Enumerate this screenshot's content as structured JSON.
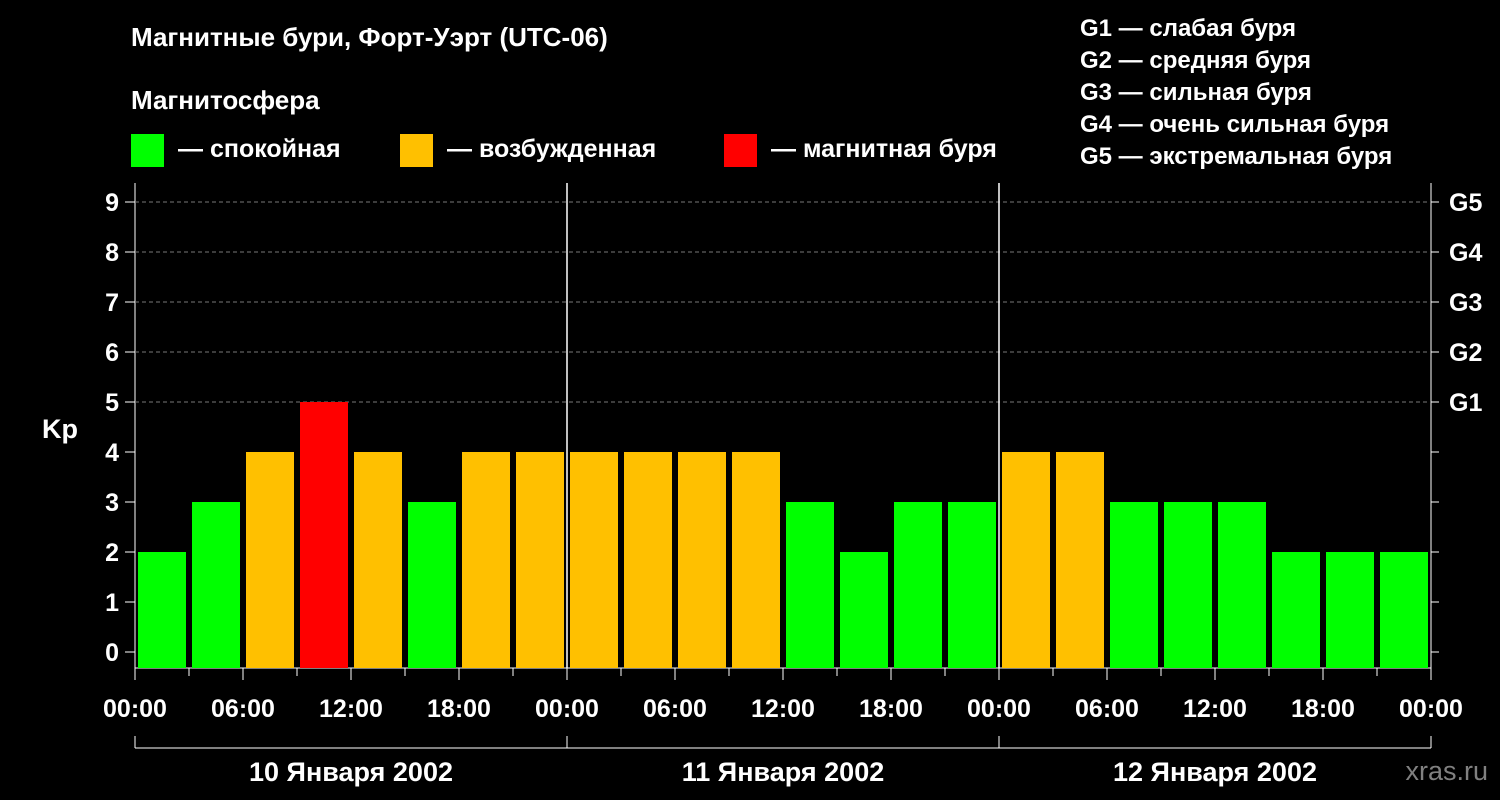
{
  "header": {
    "title": "Магнитные бури, Форт-Уэрт (UTC-06)",
    "subtitle": "Магнитосфера"
  },
  "legend": [
    {
      "label": "— спокойная",
      "color": "#00ff00"
    },
    {
      "label": "— возбужденная",
      "color": "#ffc000"
    },
    {
      "label": "— магнитная буря",
      "color": "#ff0000"
    }
  ],
  "g_scale": [
    "G1 — слабая буря",
    "G2 — средняя буря",
    "G3 — сильная буря",
    "G4 — очень сильная буря",
    "G5 — экстремальная буря"
  ],
  "watermark": "xras.ru",
  "chart_data": {
    "type": "bar",
    "ylabel": "Kp",
    "ylim": [
      0,
      9
    ],
    "y_ticks": [
      0,
      1,
      2,
      3,
      4,
      5,
      6,
      7,
      8,
      9
    ],
    "right_axis_labels": [
      {
        "y": 5,
        "label": "G1"
      },
      {
        "y": 6,
        "label": "G2"
      },
      {
        "y": 7,
        "label": "G3"
      },
      {
        "y": 8,
        "label": "G4"
      },
      {
        "y": 9,
        "label": "G5"
      }
    ],
    "x_tick_labels": [
      "00:00",
      "06:00",
      "12:00",
      "18:00",
      "00:00",
      "06:00",
      "12:00",
      "18:00",
      "00:00",
      "06:00",
      "12:00",
      "18:00",
      "00:00"
    ],
    "days": [
      "10 Января 2002",
      "11 Января 2002",
      "12 Января 2002"
    ],
    "values": [
      2,
      3,
      4,
      5,
      4,
      3,
      4,
      4,
      4,
      4,
      4,
      4,
      3,
      2,
      3,
      3,
      4,
      4,
      3,
      3,
      3,
      2,
      2,
      2
    ],
    "colors": {
      "quiet": "#00ff00",
      "unsettled": "#ffc000",
      "storm": "#ff0000"
    },
    "grid": "dashed horizontal at 5–9"
  }
}
